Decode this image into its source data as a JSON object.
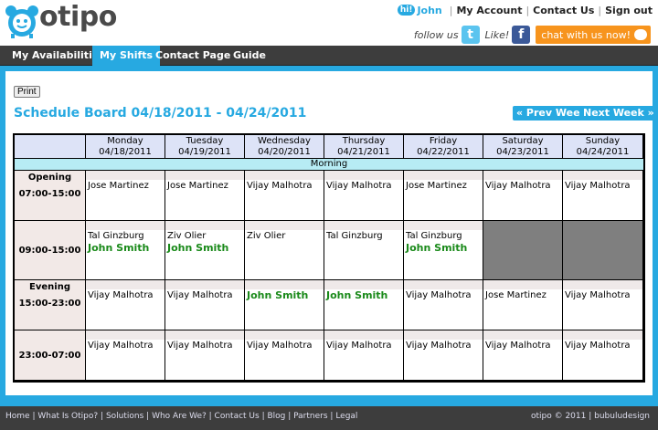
{
  "header": {
    "logo_text": "otipo",
    "greeting_badge": "hi!",
    "user_name": "John",
    "links": [
      "My Account",
      "Contact Us",
      "Sign out"
    ],
    "follow_text": "follow us",
    "like_text": "Like!",
    "twitter_glyph": "t",
    "facebook_glyph": "f",
    "chat_label": "chat with us now!"
  },
  "nav": {
    "tabs": [
      "My Availabilities",
      "My Shifts",
      "Contact Page",
      "Guide"
    ],
    "active": "My Shifts"
  },
  "main": {
    "print_label": "Print",
    "title": "Schedule Board 04/18/2011 - 04/24/2011",
    "prev_week": "« Prev Week",
    "next_week": "Next Week »"
  },
  "schedule": {
    "days": [
      {
        "name": "Monday",
        "date": "04/18/2011"
      },
      {
        "name": "Tuesday",
        "date": "04/19/2011"
      },
      {
        "name": "Wednesday",
        "date": "04/20/2011"
      },
      {
        "name": "Thursday",
        "date": "04/21/2011"
      },
      {
        "name": "Friday",
        "date": "04/22/2011"
      },
      {
        "name": "Saturday",
        "date": "04/23/2011"
      },
      {
        "name": "Sunday",
        "date": "04/24/2011"
      }
    ],
    "section": "Morning",
    "shifts": [
      {
        "label": "Opening",
        "time": "07:00-15:00",
        "cells": [
          {
            "names": [
              "Jose Martinez"
            ],
            "highlight": []
          },
          {
            "names": [
              "Jose Martinez"
            ],
            "highlight": []
          },
          {
            "names": [
              "Vijay Malhotra"
            ],
            "highlight": []
          },
          {
            "names": [
              "Vijay Malhotra"
            ],
            "highlight": []
          },
          {
            "names": [
              "Jose Martinez"
            ],
            "highlight": []
          },
          {
            "names": [
              "Vijay Malhotra"
            ],
            "highlight": []
          },
          {
            "names": [
              "Vijay Malhotra"
            ],
            "highlight": []
          }
        ]
      },
      {
        "label": "",
        "time": "09:00-15:00",
        "cells": [
          {
            "names": [
              "Tal Ginzburg"
            ],
            "highlight": [
              "John Smith"
            ]
          },
          {
            "names": [
              "Ziv Olier"
            ],
            "highlight": [
              "John Smith"
            ]
          },
          {
            "names": [
              "Ziv Olier"
            ],
            "highlight": []
          },
          {
            "names": [
              "Tal Ginzburg"
            ],
            "highlight": []
          },
          {
            "names": [
              "Tal Ginzburg"
            ],
            "highlight": [
              "John Smith"
            ]
          },
          {
            "names": [],
            "highlight": [],
            "blocked": true
          },
          {
            "names": [],
            "highlight": [],
            "blocked": true
          }
        ]
      },
      {
        "label": "Evening",
        "time": "15:00-23:00",
        "cells": [
          {
            "names": [
              "Vijay Malhotra"
            ],
            "highlight": []
          },
          {
            "names": [
              "Vijay Malhotra"
            ],
            "highlight": []
          },
          {
            "names": [],
            "highlight": [
              "John Smith"
            ]
          },
          {
            "names": [],
            "highlight": [
              "John Smith"
            ]
          },
          {
            "names": [
              "Vijay Malhotra"
            ],
            "highlight": []
          },
          {
            "names": [
              "Jose Martinez"
            ],
            "highlight": []
          },
          {
            "names": [
              "Vijay Malhotra"
            ],
            "highlight": []
          }
        ]
      },
      {
        "label": "",
        "time": "23:00-07:00",
        "cells": [
          {
            "names": [
              "Vijay Malhotra"
            ],
            "highlight": []
          },
          {
            "names": [
              "Vijay Malhotra"
            ],
            "highlight": []
          },
          {
            "names": [
              "Vijay Malhotra"
            ],
            "highlight": []
          },
          {
            "names": [
              "Vijay Malhotra"
            ],
            "highlight": []
          },
          {
            "names": [
              "Vijay Malhotra"
            ],
            "highlight": []
          },
          {
            "names": [
              "Vijay Malhotra"
            ],
            "highlight": []
          },
          {
            "names": [
              "Vijay Malhotra"
            ],
            "highlight": []
          }
        ]
      }
    ]
  },
  "footer": {
    "links": [
      "Home",
      "What Is Otipo?",
      "Solutions",
      "Who Are We?",
      "Contact Us",
      "Blog",
      "Partners",
      "Legal"
    ],
    "copyright": "otipo © 2011 | bubuludesign"
  },
  "colors": {
    "accent": "#27a9e1",
    "nav_bg": "#3d3d3d",
    "highlight_name": "#1a8a1a",
    "blocked_cell": "#7f7f7f"
  }
}
